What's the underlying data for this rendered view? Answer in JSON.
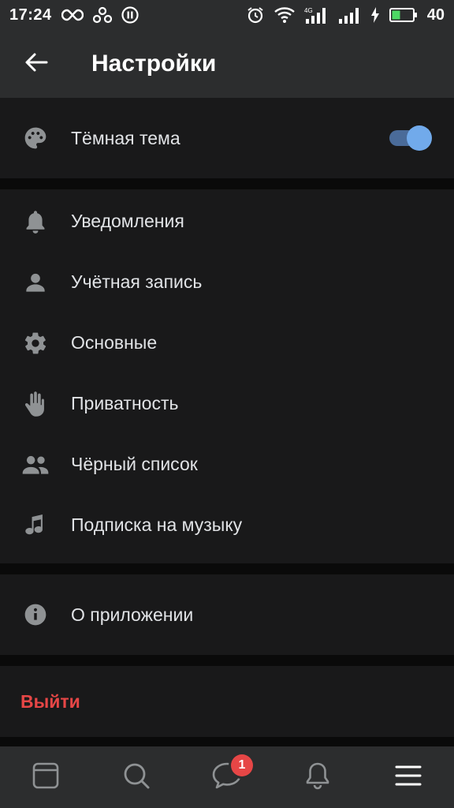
{
  "status_bar": {
    "time": "17:24",
    "battery_percent": "40",
    "icons_left": [
      "infinity-icon",
      "vk-app-icon",
      "pause-icon"
    ],
    "icons_right": [
      "alarm-icon",
      "wifi-icon",
      "signal-4g-icon",
      "signal-icon",
      "charging-icon",
      "battery-icon"
    ],
    "battery_level": 0.4
  },
  "header": {
    "title": "Настройки",
    "back_icon": "arrow-left-icon"
  },
  "theme_group": {
    "label": "Тёмная тема",
    "icon": "palette-icon",
    "toggle_on": true
  },
  "settings_items": [
    {
      "label": "Уведомления",
      "icon": "bell-icon"
    },
    {
      "label": "Учётная запись",
      "icon": "user-icon"
    },
    {
      "label": "Основные",
      "icon": "gear-icon"
    },
    {
      "label": "Приватность",
      "icon": "hand-icon"
    },
    {
      "label": "Чёрный список",
      "icon": "users-icon"
    },
    {
      "label": "Подписка на музыку",
      "icon": "music-note-icon"
    }
  ],
  "about": {
    "label": "О приложении",
    "icon": "info-icon"
  },
  "logout": {
    "label": "Выйти"
  },
  "bottom_nav": {
    "items": [
      "newsfeed-icon",
      "search-icon",
      "messages-icon",
      "notifications-icon",
      "menu-icon"
    ],
    "messages_badge": "1"
  },
  "colors": {
    "background": "#0a0a0a",
    "header": "#2c2d2e",
    "group": "#19191a",
    "text": "#e1e3e6",
    "icon": "#8f9294",
    "accent": "#71aaeb",
    "destructive": "#e64646"
  }
}
